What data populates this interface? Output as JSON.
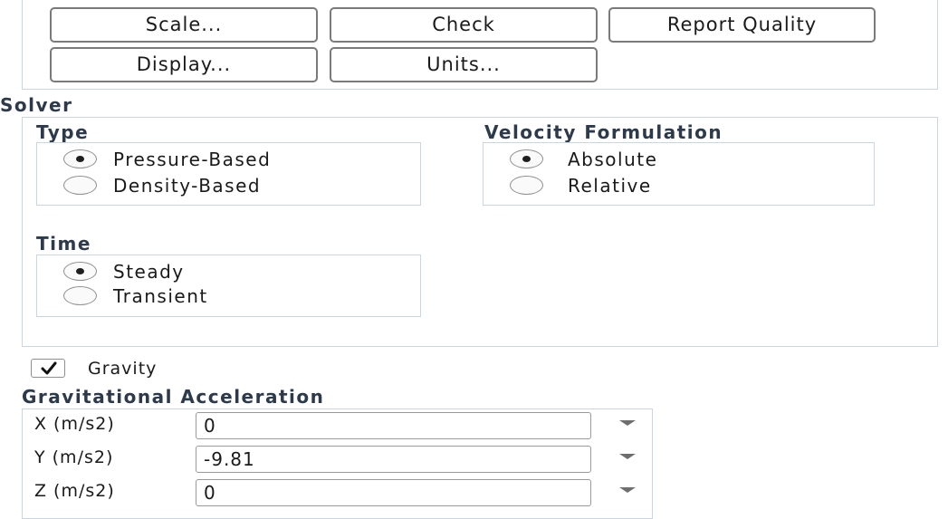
{
  "mesh": {
    "buttons": {
      "scale": "Scale...",
      "check": "Check",
      "report_quality": "Report Quality",
      "display": "Display...",
      "units": "Units..."
    }
  },
  "solver": {
    "title": "Solver",
    "type": {
      "title": "Type",
      "options": [
        {
          "label": "Pressure-Based",
          "selected": true
        },
        {
          "label": "Density-Based",
          "selected": false
        }
      ]
    },
    "velocity_formulation": {
      "title": "Velocity Formulation",
      "options": [
        {
          "label": "Absolute",
          "selected": true
        },
        {
          "label": "Relative",
          "selected": false
        }
      ]
    },
    "time": {
      "title": "Time",
      "options": [
        {
          "label": "Steady",
          "selected": true
        },
        {
          "label": "Transient",
          "selected": false
        }
      ]
    }
  },
  "gravity": {
    "label": "Gravity",
    "checked": true
  },
  "gravitational_acceleration": {
    "title": "Gravitational Acceleration",
    "fields": [
      {
        "label": "X (m/s2)",
        "value": "0"
      },
      {
        "label": "Y (m/s2)",
        "value": "-9.81"
      },
      {
        "label": "Z (m/s2)",
        "value": "0"
      }
    ]
  },
  "icons": {
    "radio_selected": "radio-selected-icon",
    "radio_unselected": "radio-unselected-icon",
    "checkmark": "checkmark-icon",
    "dropdown": "chevron-down-icon"
  }
}
